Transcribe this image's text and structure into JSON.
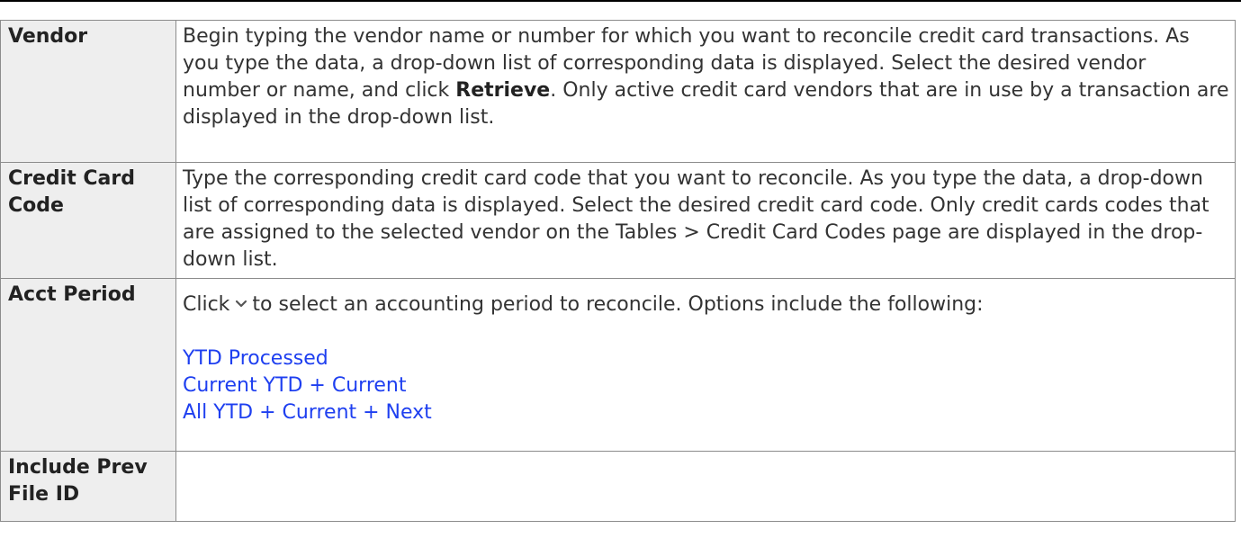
{
  "rows": {
    "vendor": {
      "label": "Vendor",
      "text_a": "Begin typing the vendor name or number for which you want to reconcile credit card transactions. As you type the data, a drop-down list of corresponding data is displayed. Select the desired vendor number or name, and click ",
      "bold": "Retrieve",
      "text_b": ". Only active credit card vendors that are in use by a transaction are displayed in the drop-down list."
    },
    "credit_card_code": {
      "label": "Credit Card Code",
      "text": "Type the corresponding credit card code that you want to reconcile. As you type the data, a drop-down list of corresponding data is displayed. Select the desired credit card code. Only credit cards codes that are assigned to the selected vendor on the Tables > Credit Card Codes page are displayed in the drop-down list."
    },
    "acct_period": {
      "label": "Acct Period",
      "text_a": "Click",
      "icon": "chevron-down-icon",
      "text_b": "to select an accounting period to reconcile. Options include the following:",
      "options": [
        "YTD Processed",
        "Current YTD + Current",
        "All YTD + Current + Next"
      ]
    },
    "include_prev_file_id": {
      "label": "Include Prev File ID",
      "text": ""
    }
  },
  "colors": {
    "link": "#1e3ff0",
    "label_bg": "#eeeeee",
    "border": "#8c8c8c"
  }
}
